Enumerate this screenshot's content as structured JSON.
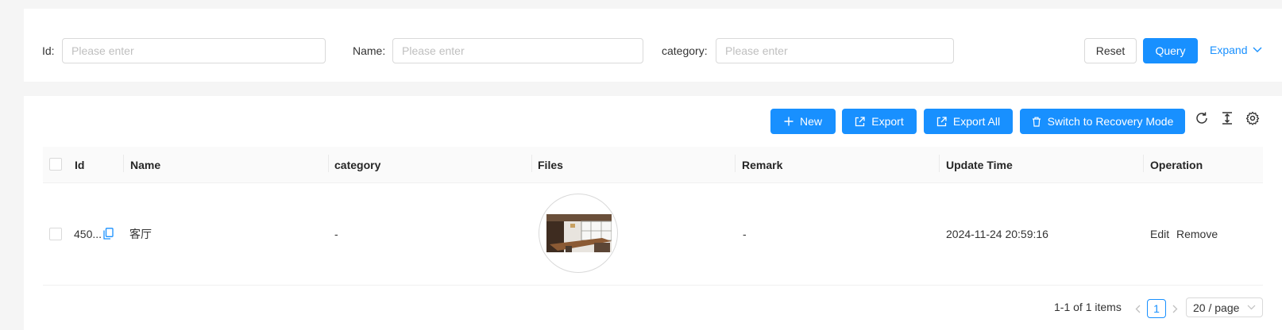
{
  "search": {
    "fields": [
      {
        "label": "Id:",
        "placeholder": "Please enter",
        "value": ""
      },
      {
        "label": "Name:",
        "placeholder": "Please enter",
        "value": ""
      },
      {
        "label": "category:",
        "placeholder": "Please enter",
        "value": ""
      }
    ],
    "reset_label": "Reset",
    "query_label": "Query",
    "expand_label": "Expand"
  },
  "toolbar": {
    "new_label": "New",
    "export_label": "Export",
    "export_all_label": "Export All",
    "recovery_label": "Switch to Recovery Mode"
  },
  "table": {
    "columns": [
      "Id",
      "Name",
      "category",
      "Files",
      "Remark",
      "Update Time",
      "Operation"
    ],
    "rows": [
      {
        "id": "450...",
        "name": "客厅",
        "category": "-",
        "files": "living-room-photo",
        "remark": "-",
        "update_time": "2024-11-24 20:59:16",
        "edit_label": "Edit",
        "remove_label": "Remove"
      }
    ]
  },
  "pagination": {
    "summary": "1-1 of 1 items",
    "current_page": "1",
    "page_size": "20 / page"
  },
  "colors": {
    "primary": "#1890ff",
    "header_bg": "#fafafa",
    "border": "#d9d9d9"
  }
}
